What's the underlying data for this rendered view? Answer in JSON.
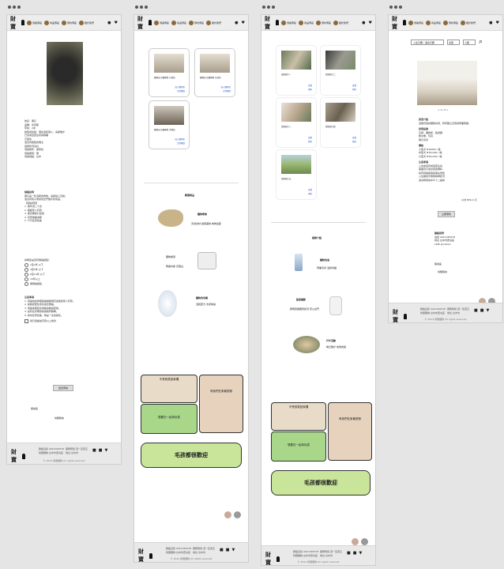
{
  "header": {
    "logo_text": "財寶",
    "nav": [
      "領養專區",
      "商品專區",
      "預約專區",
      "關於我們"
    ],
    "account_icon": "user-icon",
    "cart_icon": "heart-icon"
  },
  "footer": {
    "logo_text": "財寶",
    "col1": [
      "聯絡資訊 0912345678",
      "財寶寵物 台中市西屯區"
    ],
    "col2": [
      "服務時間 週一至週五",
      "地址 台中市"
    ],
    "social": [
      "fb-icon",
      "ig-icon",
      "line-icon"
    ],
    "copyright": "© 2024 財寶寵物 All rights reserved"
  },
  "screen1": {
    "dog_caption": "",
    "info": [
      "姓名：黑仔",
      "品種：米克斯",
      "年齡：2歲",
      "體型與性格：個性溫和親人，喜歡散步",
      "已完成疫苗注射與除蟲",
      "已結紮",
      "適合有經驗的飼主",
      "健康狀況良好",
      "領養條件：需家訪",
      "領養費用：無",
      "領養地點：台中"
    ],
    "intro_title": "領養說明",
    "intro": [
      "黑仔是一隻溫柔的狗狗，喜歡與人互動。",
      "適合有院子或常帶出門散步的家庭。",
      "【領養須知】",
      "1. 需年滿二十歲",
      "2. 需經家人同意",
      "3. 需定期施打疫苗",
      "4. 同意後續追蹤",
      "5. 不可任意棄養"
    ],
    "question": "請問您是否有飼養經驗？",
    "options": [
      "1至2年 以下",
      "3至5年 以下",
      "6至10年 以下",
      "10年以上",
      "無飼養經驗"
    ],
    "notes_title": "注意事項",
    "notes": [
      "1. 領養前請詳細閱讀相關規定並確認家人同意。",
      "2. 請確認居住環境適合飼養。",
      "3. 領養後需配合後續追蹤與回報。",
      "4. 如有任何問題請與我們聯繫。",
      "5. 請勿任意棄養，牠是一生的責任。"
    ],
    "agree": "我已閱讀並同意以上條款",
    "submit": "送出申請",
    "reply_label": "留言區",
    "reply_hint": "尚無留言"
  },
  "screen2": {
    "products": [
      {
        "cap": "寵物床 舒適睡墊 白色款",
        "btn1": "加入購物車",
        "btn2": "立即購買"
      },
      {
        "cap": "寵物床 舒適睡墊 灰色款",
        "btn1": "加入購物車",
        "btn2": "立即購買"
      },
      {
        "cap": "寵物床 舒適睡墊 木質款",
        "btn1": "加入購物車",
        "btn2": "立即購買"
      }
    ],
    "section_title": "精選商品",
    "items": [
      {
        "name": "寵物零食",
        "desc": "天然食材 健康美味 狗狗最愛"
      },
      {
        "name": "寵物罐頭",
        "desc": "營養均衡 高蛋白"
      },
      {
        "name": "寵物洗毛精",
        "desc": "溫和配方 清潔除臭"
      }
    ],
    "cartoon": [
      "不會寂寞回家囉",
      "有我們在家最舒服",
      "想要在一起來玩耍",
      "毛孩都很歡迎"
    ]
  },
  "screen3": {
    "gallery": [
      {
        "cap": "環境照片一",
        "btn1": "查看",
        "btn2": "預約"
      },
      {
        "cap": "環境照片二",
        "btn1": "查看",
        "btn2": "預約"
      },
      {
        "cap": "環境照片三",
        "btn1": "查看",
        "btn2": "預約"
      },
      {
        "cap": "環境照片四",
        "btn1": "查看",
        "btn2": "預約"
      },
      {
        "cap": "環境照片五",
        "btn1": "查看",
        "btn2": "預約"
      }
    ],
    "section_title": "服務介紹",
    "items": [
      {
        "name": "寵物洗澡",
        "desc": "專業清潔 溫和呵護"
      },
      {
        "name": "監控攝影",
        "desc": "即時查看寶貝狀況 安心出門"
      },
      {
        "name": "戶外活動",
        "desc": "每日散步 快樂成長"
      }
    ],
    "cartoon": [
      "不會寂寞回家囉",
      "有我們在家最舒服",
      "想要在一起來玩耍",
      "毛孩都很歡迎"
    ]
  },
  "screen4": {
    "search": {
      "placeholder": "入住日期 / 退房日期",
      "select1": "房型",
      "select2": "人數"
    },
    "pager": "< 1 / 3 >",
    "room_title": "房型介紹",
    "room_desc": "溫馨舒適的寵物房間，附有獨立空間與專業照顧。",
    "facility_title": "房間設施",
    "facilities": [
      "空調、寵物床、監視器",
      "飲水機、玩具",
      "每日清潔"
    ],
    "price_title": "價格",
    "prices": [
      "小型犬 NT$800 / 晚",
      "中型犬 NT$1000 / 晚",
      "大型犬 NT$1200 / 晚"
    ],
    "notice_title": "注意事項",
    "notices": [
      "入住前須完成疫苗注射",
      "需攜帶平常食用的飼料",
      "如有特殊疾病請事先告知",
      "入住期間可隨時詢問狀況",
      "退房時間為中午十二點前"
    ],
    "total": "小計 NT$ 0 元",
    "book_btn": "立即預約",
    "contact_title": "聯絡我們",
    "contact": [
      "電話 0912345678",
      "地址 台中市西屯區",
      "LINE @caibao"
    ],
    "reply_label": "留言區",
    "reply_hint": "尚無留言"
  }
}
